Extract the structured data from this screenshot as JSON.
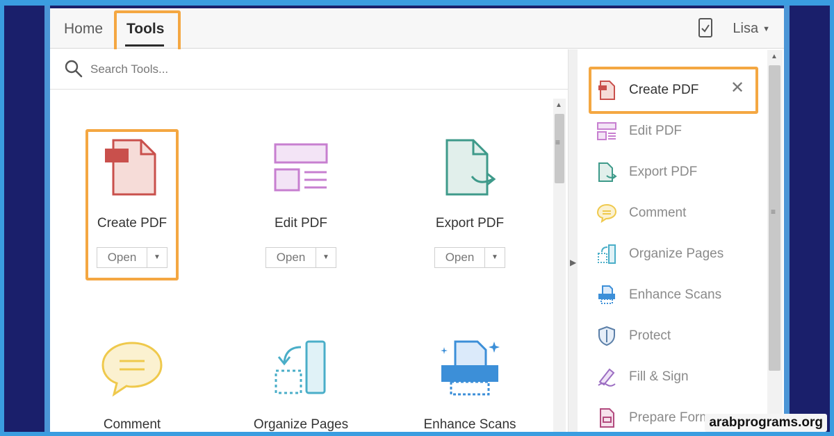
{
  "header": {
    "tabs": [
      {
        "label": "Home"
      },
      {
        "label": "Tools",
        "active": true
      }
    ],
    "user": "Lisa"
  },
  "search": {
    "placeholder": "Search Tools..."
  },
  "tools": [
    {
      "name": "Create PDF",
      "icon": "create-pdf-icon",
      "open_label": "Open",
      "highlighted": true
    },
    {
      "name": "Edit PDF",
      "icon": "edit-pdf-icon",
      "open_label": "Open"
    },
    {
      "name": "Export PDF",
      "icon": "export-pdf-icon",
      "open_label": "Open"
    },
    {
      "name": "Comment",
      "icon": "comment-icon"
    },
    {
      "name": "Organize Pages",
      "icon": "organize-pages-icon"
    },
    {
      "name": "Enhance Scans",
      "icon": "enhance-scans-icon"
    }
  ],
  "right_panel": {
    "items": [
      {
        "label": "Create PDF",
        "icon": "create-pdf-icon",
        "active": true
      },
      {
        "label": "Edit PDF",
        "icon": "edit-pdf-icon"
      },
      {
        "label": "Export PDF",
        "icon": "export-pdf-icon"
      },
      {
        "label": "Comment",
        "icon": "comment-icon"
      },
      {
        "label": "Organize Pages",
        "icon": "organize-pages-icon"
      },
      {
        "label": "Enhance Scans",
        "icon": "enhance-scans-icon"
      },
      {
        "label": "Protect",
        "icon": "shield-icon"
      },
      {
        "label": "Fill & Sign",
        "icon": "pen-icon"
      },
      {
        "label": "Prepare Form",
        "icon": "form-icon"
      }
    ]
  },
  "colors": {
    "highlight": "#f4a742",
    "create": "#c9504c",
    "edit": "#c77fd0",
    "export": "#3e9a8a",
    "comment": "#efc94c",
    "organize": "#4aaec8",
    "enhance": "#3c8fd8"
  },
  "watermark": "arabprograms.org"
}
